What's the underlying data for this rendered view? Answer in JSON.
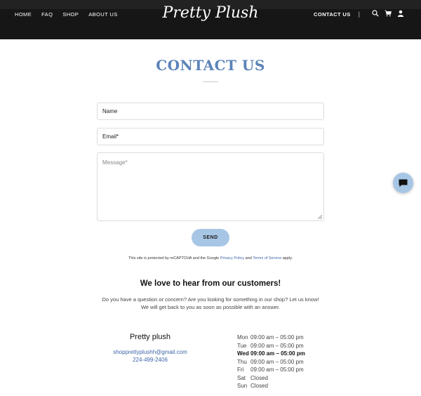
{
  "header": {
    "nav_left": [
      "HOME",
      "FAQ",
      "SHOP",
      "ABOUT US"
    ],
    "logo": "Pretty Plush",
    "nav_right_active": "CONTACT US",
    "icons": [
      "search-icon",
      "cart-icon",
      "user-icon"
    ]
  },
  "page": {
    "title": "CONTACT US"
  },
  "form": {
    "name_placeholder": "Name",
    "email_placeholder": "Email*",
    "message_placeholder": "Message*",
    "send_label": "SEND"
  },
  "recaptcha": {
    "prefix": "This site is protected by reCAPTCHA and the Google ",
    "privacy": "Privacy Policy",
    "and": " and ",
    "terms": "Terms of Service",
    "suffix": " apply."
  },
  "intro": {
    "heading": "We love to hear from our customers!",
    "body": "Do you have a question or concern? Are you looking for something in our shop? Let us know! We will get back to you as soon as possible with an answer."
  },
  "business": {
    "name": "Pretty plush",
    "email": "shopprettyplushh@gmail.com",
    "phone": "224-499-2406"
  },
  "hours": [
    {
      "day": "Mon",
      "time": "09:00 am – 05:00 pm"
    },
    {
      "day": "Tue",
      "time": "09:00 am – 05:00 pm"
    },
    {
      "day": "Wed",
      "time": "09:00 am – 05:00 pm"
    },
    {
      "day": "Thu",
      "time": "09:00 am – 05:00 pm"
    },
    {
      "day": "Fri",
      "time": "09:00 am – 05:00 pm"
    },
    {
      "day": "Sat",
      "time": "Closed"
    },
    {
      "day": "Sun",
      "time": "Closed"
    }
  ],
  "today_index": 2,
  "colors": {
    "header_bg": "#161616",
    "accent": "#a7c6e6",
    "title": "#5b83b8",
    "link": "#3c66a8"
  },
  "chat_icon": "chat-icon"
}
